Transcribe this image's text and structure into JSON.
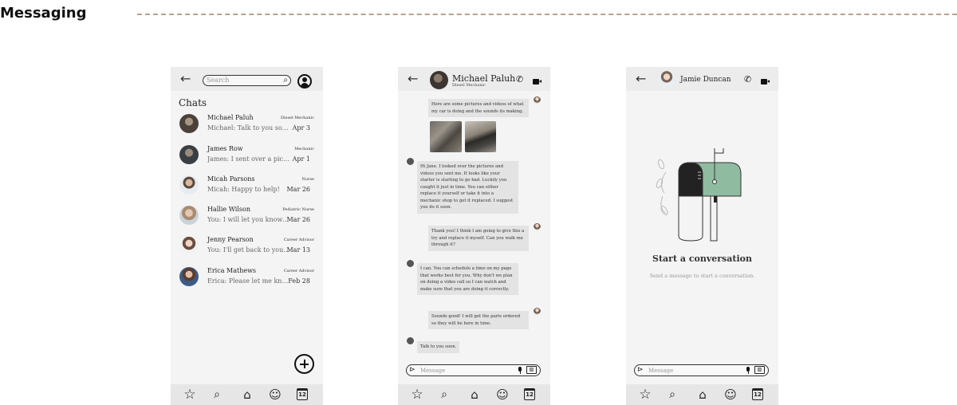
{
  "page": {
    "title": "Messaging"
  },
  "icons": {
    "back": "←",
    "search": "⌕",
    "send": "⊳",
    "image": "▨",
    "star": "☆",
    "nav_search": "⌕",
    "home": "⌂",
    "chat": "☺",
    "phone": "✆"
  },
  "chat_list": {
    "search_placeholder": "Search",
    "heading": "Chats",
    "items": [
      {
        "name": "Michael Paluh",
        "role": "Diesel Mechanic",
        "preview": "Michael: Talk to you soon.",
        "date": "Apr 3"
      },
      {
        "name": "James Row",
        "role": "Mechanic",
        "preview": "James: I sent over a picture...",
        "date": "Apr 1"
      },
      {
        "name": "Micah Parsons",
        "role": "Nurse",
        "preview": "Micah: Happy to help!",
        "date": "Mar 26"
      },
      {
        "name": "Hallie Wilson",
        "role": "Pediatric Nurse",
        "preview": "You: I will let you know if...",
        "date": "Mar 26"
      },
      {
        "name": "Jenny Pearson",
        "role": "Career Advisor",
        "preview": "You: I'll get back to you as...",
        "date": "Mar 13"
      },
      {
        "name": "Erica Mathews",
        "role": "Career Advisor",
        "preview": "Erica: Please let me know...",
        "date": "Feb 28"
      }
    ]
  },
  "conversation": {
    "contact_name": "Michael Paluh",
    "contact_role": "Diesel Mechanic",
    "messages": [
      {
        "from": "me",
        "text": "Here are some pictures and videos of what my car is doing and the sounds its making."
      },
      {
        "from": "them",
        "text": "Hi Jane. I looked over the pictures and videos you sent me. It looks like your starter is starting to go bad. Luckily you caught it just in time. You can either replace it yourself or take it into a mechanic shop to get it replaced. I suggest you do it soon."
      },
      {
        "from": "me",
        "text": "Thank you! I think I am going to give this a try and replace it myself. Can you walk me through it?"
      },
      {
        "from": "them",
        "text": "I can. You can schedule a time on my page that works best for you. Why don't we plan on doing a video call so I can watch and make sure that you are doing it correctly."
      },
      {
        "from": "me",
        "text": "Sounds good! I will get the parts ordered so they will be here in time."
      },
      {
        "from": "them",
        "text": "Talk to you soon."
      }
    ],
    "message_placeholder": "Message"
  },
  "new_conversation": {
    "contact_name": "Jamie Duncan",
    "title": "Start a conversation",
    "subtitle": "Send a message to start a conversation.",
    "message_placeholder": "Message"
  },
  "bottom_nav": {
    "calendar_day": "12"
  },
  "colors": {
    "accent_dash": "#b8a18a",
    "mailbox_green": "#8fbba0",
    "bubble": "#e3e3e3",
    "nav_bar": "#e6e6e6"
  }
}
